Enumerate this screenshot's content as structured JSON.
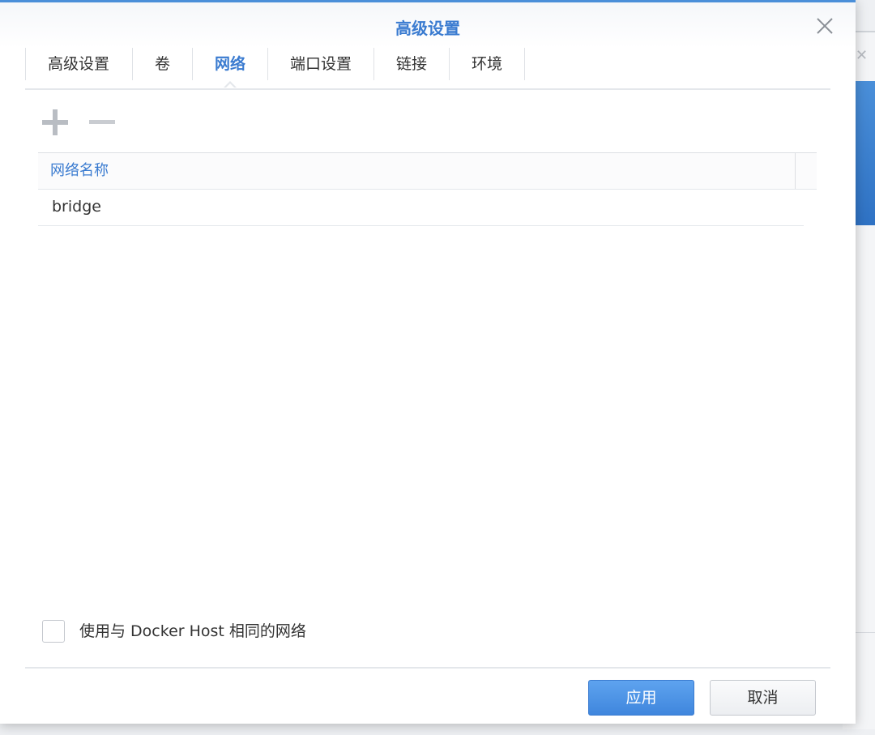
{
  "dialog": {
    "title": "高级设置"
  },
  "tabs": [
    {
      "label": "高级设置"
    },
    {
      "label": "卷"
    },
    {
      "label": "网络"
    },
    {
      "label": "端口设置"
    },
    {
      "label": "链接"
    },
    {
      "label": "环境"
    }
  ],
  "active_tab": "网络",
  "toolbar": {
    "add_icon": "plus-icon",
    "remove_icon": "minus-icon"
  },
  "grid": {
    "columns": [
      {
        "label": "网络名称"
      }
    ],
    "rows": [
      {
        "name": "bridge"
      }
    ]
  },
  "host_network": {
    "label": "使用与 Docker Host 相同的网络",
    "checked": false
  },
  "footer": {
    "apply_label": "应用",
    "cancel_label": "取消"
  },
  "colors": {
    "accent": "#3a7bd0",
    "primary_button": "#4a8fe3"
  }
}
